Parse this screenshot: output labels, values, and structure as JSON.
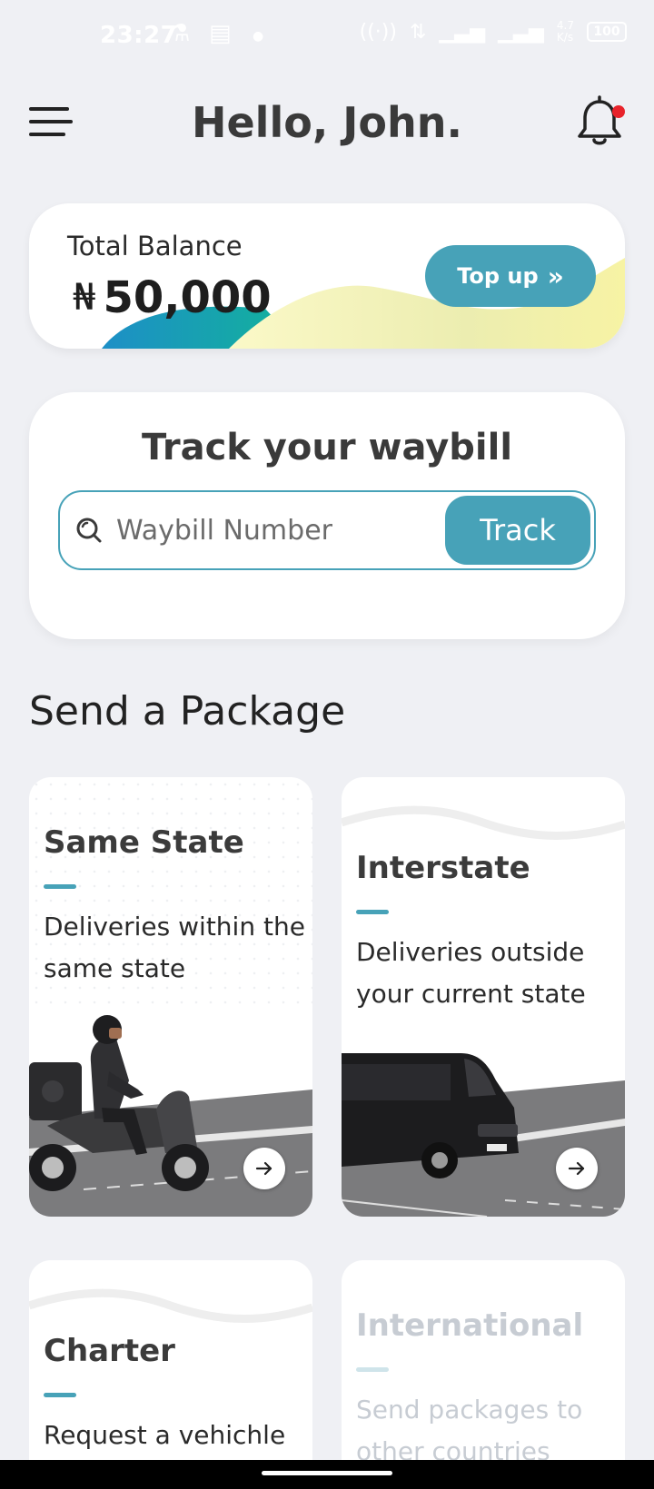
{
  "status_bar": {
    "time": "23:27",
    "icons": [
      "flask-icon",
      "message-icon",
      "dot-icon",
      "hotspot-icon",
      "data-arrows-icon",
      "signal-4g-icon",
      "signal-icon"
    ],
    "network_speed": "4.7\nK/s",
    "battery": "100"
  },
  "header": {
    "title": "Hello, John.",
    "menu_icon": "hamburger-menu-icon",
    "bell_icon": "bell-icon",
    "notification_dot_color": "#e8232b"
  },
  "balance": {
    "label": "Total Balance",
    "currency_symbol": "₦",
    "amount": "50,000",
    "topup_label": "Top up",
    "topup_icon": "»"
  },
  "track": {
    "title": "Track your waybill",
    "placeholder": "Waybill Number",
    "button_label": "Track"
  },
  "section": {
    "title": "Send a Package"
  },
  "cards": {
    "same_state": {
      "title": "Same State",
      "description": "Deliveries within the same state",
      "illustration": "scooter-rider"
    },
    "interstate": {
      "title": "Interstate",
      "description": "Deliveries outside your current state",
      "illustration": "van"
    },
    "charter": {
      "title": "Charter",
      "description": "Request a vehichle"
    },
    "international": {
      "title": "International",
      "description": "Send packages to other countries"
    }
  },
  "colors": {
    "accent": "#47a2b8",
    "background": "#eff0f4",
    "card": "#ffffff",
    "alert": "#e8232b"
  }
}
